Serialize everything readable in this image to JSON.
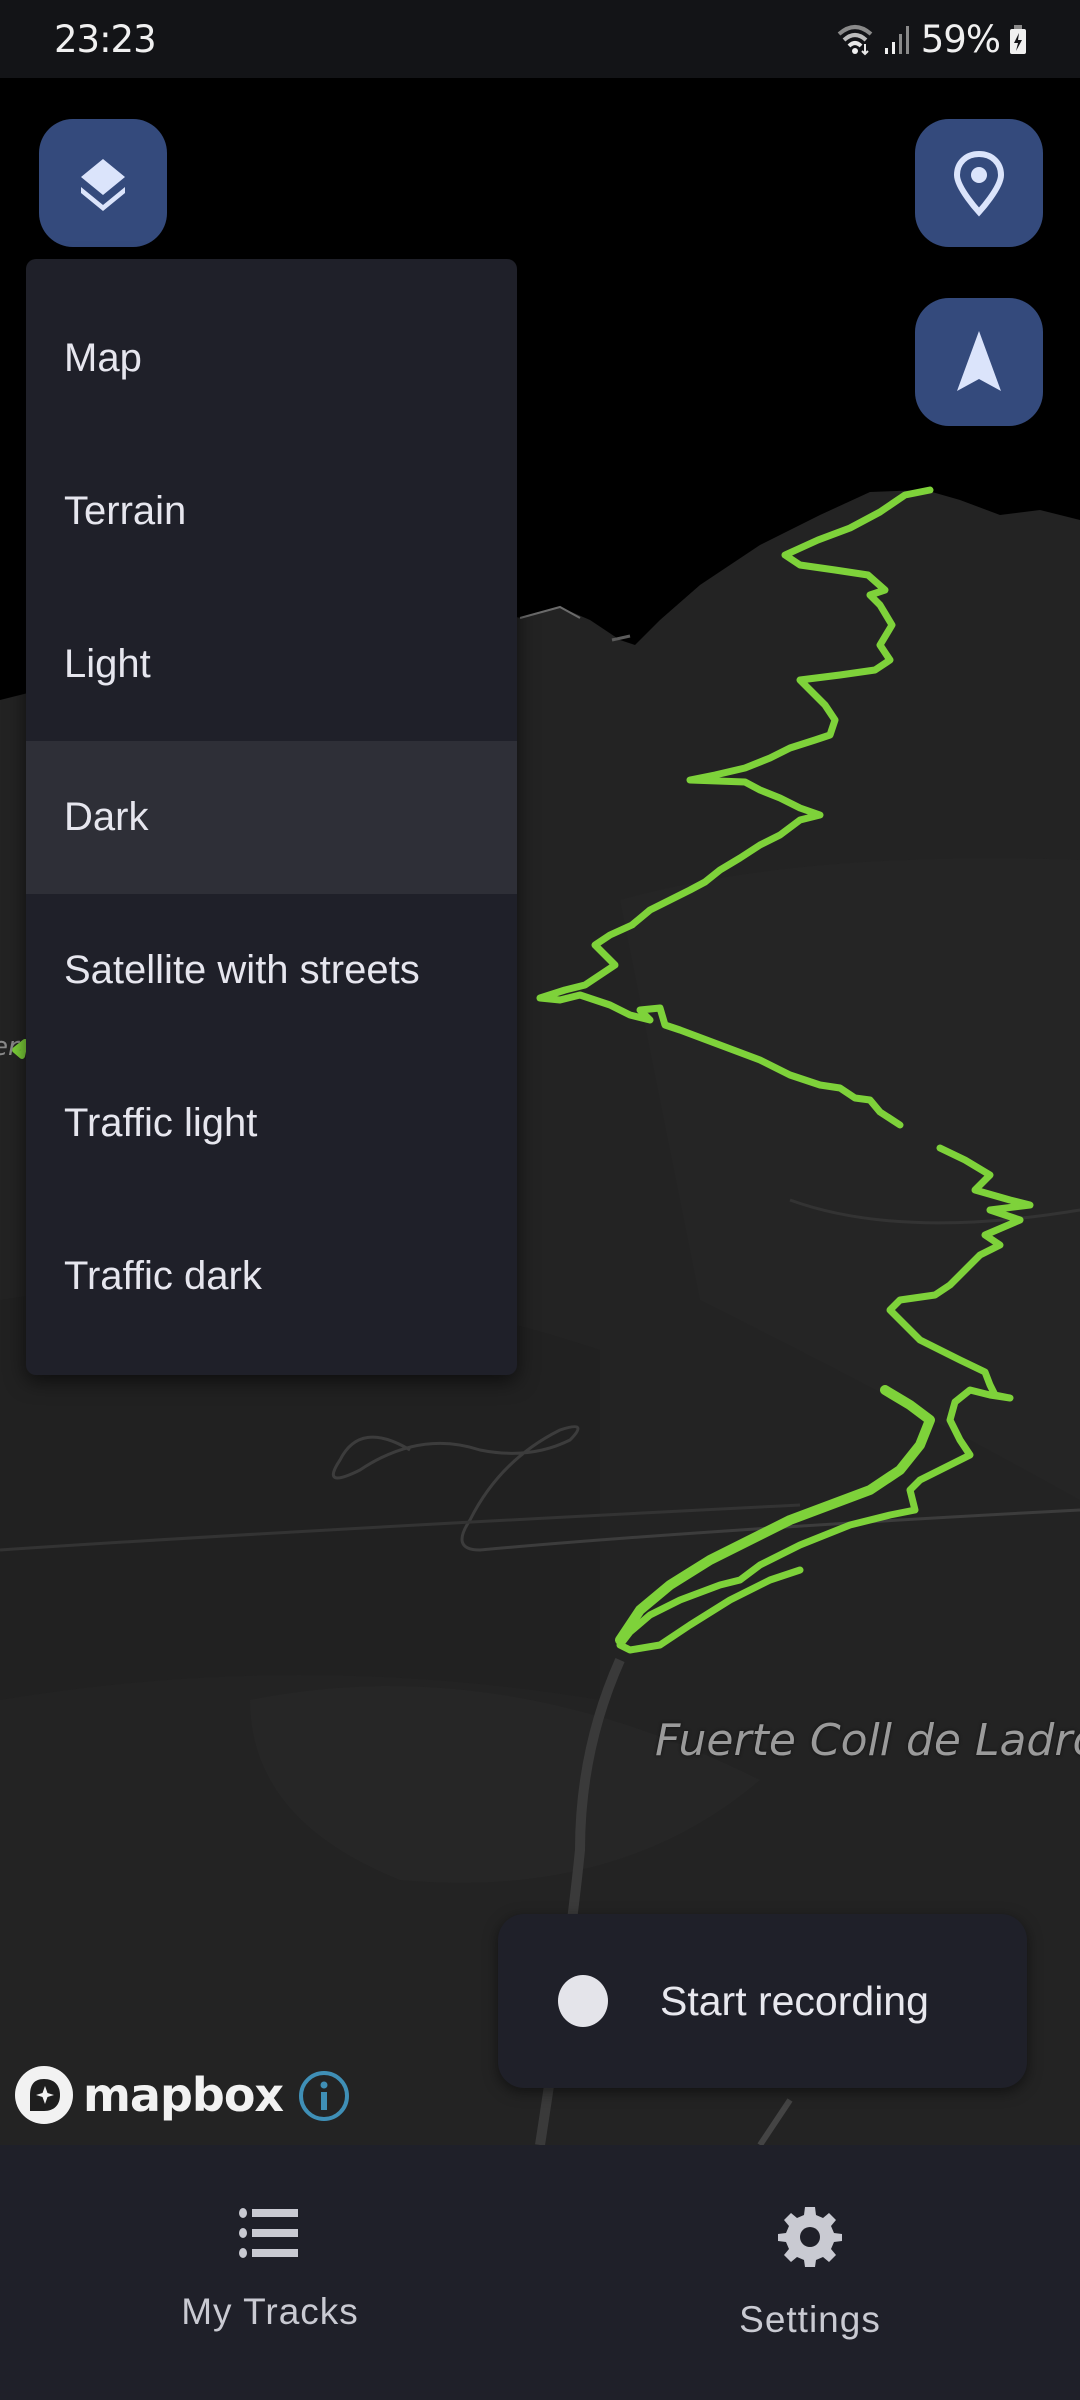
{
  "status_bar": {
    "time": "23:23",
    "battery": "59%",
    "icons": [
      "wifi-icon",
      "signal-icon",
      "battery-charging-icon"
    ]
  },
  "map": {
    "place_label": "Fuerte Coll de Ladro",
    "partial_label": "er",
    "track_color": "#7ed23a",
    "attribution": "mapbox"
  },
  "controls": {
    "layers_icon": "layers-icon",
    "location_icon": "map-pin-icon",
    "navigate_icon": "navigation-arrow-icon",
    "accent": "#344a7c"
  },
  "style_menu": {
    "selected": "Dark",
    "items": [
      {
        "label": "Map"
      },
      {
        "label": "Terrain"
      },
      {
        "label": "Light"
      },
      {
        "label": "Dark"
      },
      {
        "label": "Satellite with streets"
      },
      {
        "label": "Traffic light"
      },
      {
        "label": "Traffic dark"
      }
    ]
  },
  "record_button": {
    "label": "Start recording"
  },
  "bottom_nav": {
    "items": [
      {
        "label": "My Tracks",
        "icon": "list-icon"
      },
      {
        "label": "Settings",
        "icon": "gear-icon"
      }
    ]
  }
}
